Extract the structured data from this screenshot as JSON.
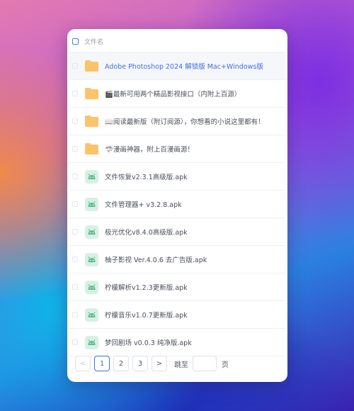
{
  "header": {
    "column_label": "文件名"
  },
  "colors": {
    "accent": "#3c6fe6",
    "folder": "#fcc36a",
    "apk_icon_bg": "#d8f0e4",
    "apk_icon_fg": "#5bbf8e"
  },
  "files": [
    {
      "name": "Adobe Photoshop 2024 解锁版 Mac+Windows版",
      "type": "folder",
      "icon": "folder-icon"
    },
    {
      "name": "🎬最新可用两个精品影视接口（内附上百源）",
      "type": "folder",
      "icon": "folder-icon"
    },
    {
      "name": "📖阅读最新版（附订阅源），你想看的小说这里都有！",
      "type": "folder",
      "icon": "folder-icon"
    },
    {
      "name": "🦈漫画神器，附上百漫画源！",
      "type": "folder",
      "icon": "folder-icon"
    },
    {
      "name": "文件恢复v2.3.1高级版.apk",
      "type": "apk",
      "icon": "android-icon"
    },
    {
      "name": "文件管理器+ v3.2.8.apk",
      "type": "apk",
      "icon": "android-icon"
    },
    {
      "name": "极光优化v8.4.0高级版.apk",
      "type": "apk",
      "icon": "android-icon"
    },
    {
      "name": "柚子影视 Ver.4.0.6 去广告版.apk",
      "type": "apk",
      "icon": "android-icon"
    },
    {
      "name": "柠檬解析v1.2.3更新版.apk",
      "type": "apk",
      "icon": "android-icon"
    },
    {
      "name": "柠檬音乐v1.0.7更新版.apk",
      "type": "apk",
      "icon": "android-icon"
    },
    {
      "name": "梦回剧场 v0.0.3 纯净版.apk",
      "type": "apk",
      "icon": "android-icon"
    }
  ],
  "pagination": {
    "prev": "<",
    "pages": [
      "1",
      "2",
      "3"
    ],
    "current_page": "1",
    "next": ">",
    "jump_label": "跳至",
    "jump_value": "",
    "page_unit": "页"
  }
}
